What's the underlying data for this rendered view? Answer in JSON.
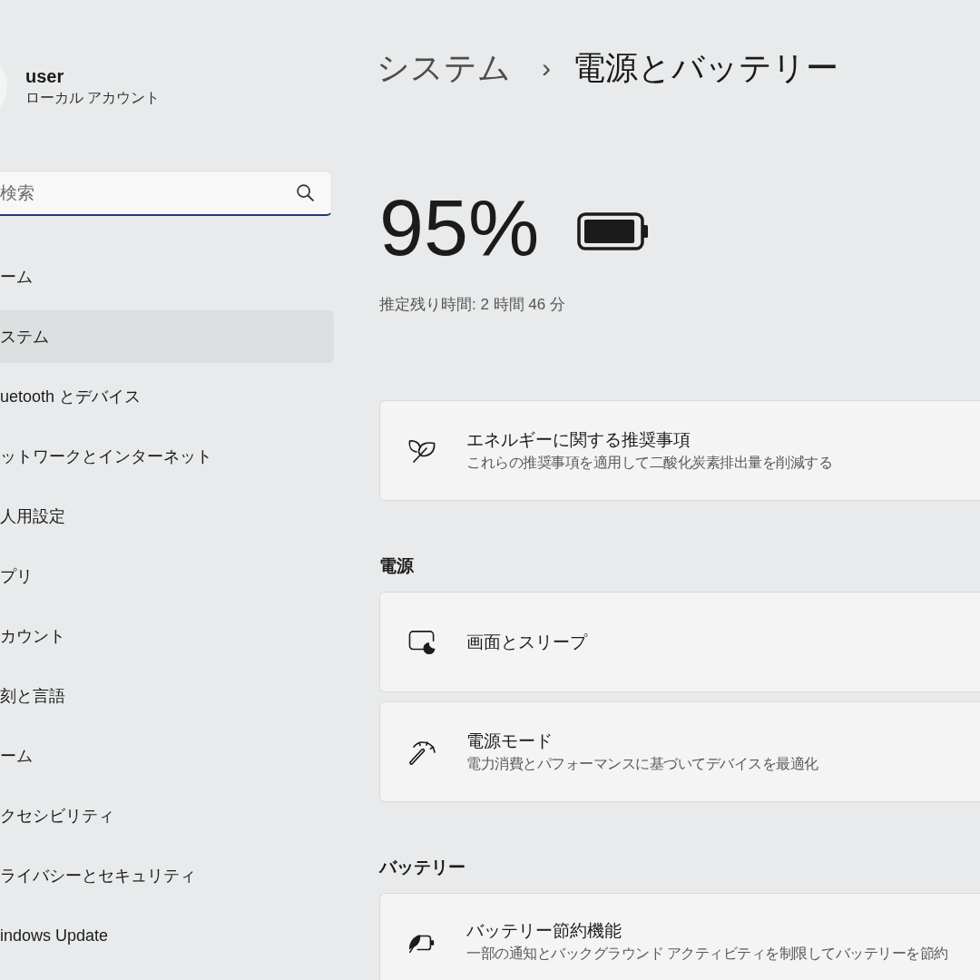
{
  "account": {
    "name": "user",
    "type": "ローカル アカウント"
  },
  "search": {
    "placeholder": "検索"
  },
  "sidebar": {
    "items": [
      {
        "label": "ーム",
        "selected": false
      },
      {
        "label": "ステム",
        "selected": true
      },
      {
        "label": "uetooth とデバイス",
        "selected": false
      },
      {
        "label": "ットワークとインターネット",
        "selected": false
      },
      {
        "label": "人用設定",
        "selected": false
      },
      {
        "label": "プリ",
        "selected": false
      },
      {
        "label": "カウント",
        "selected": false
      },
      {
        "label": "刻と言語",
        "selected": false
      },
      {
        "label": "ーム",
        "selected": false
      },
      {
        "label": "クセシビリティ",
        "selected": false
      },
      {
        "label": "ライバシーとセキュリティ",
        "selected": false
      },
      {
        "label": "indows Update",
        "selected": false
      }
    ]
  },
  "breadcrumb": {
    "parent": "システム",
    "separator": "›",
    "current": "電源とバッテリー"
  },
  "battery": {
    "percent": "95%",
    "level": 0.95,
    "estimate": "推定残り時間: 2 時間 46 分"
  },
  "sections": [
    {
      "cards": [
        {
          "kind": "energy",
          "title": "エネルギーに関する推奨事項",
          "description": "これらの推奨事項を適用して二酸化炭素排出量を削減する"
        }
      ]
    },
    {
      "heading": "電源",
      "cards": [
        {
          "kind": "display",
          "title": "画面とスリープ"
        },
        {
          "kind": "mode",
          "title": "電源モード",
          "description": "電力消費とパフォーマンスに基づいてデバイスを最適化"
        }
      ]
    },
    {
      "heading": "バッテリー",
      "cards": [
        {
          "kind": "saver",
          "title": "バッテリー節約機能",
          "description": "一部の通知とバックグラウンド アクティビティを制限してバッテリーを節約"
        }
      ]
    }
  ]
}
